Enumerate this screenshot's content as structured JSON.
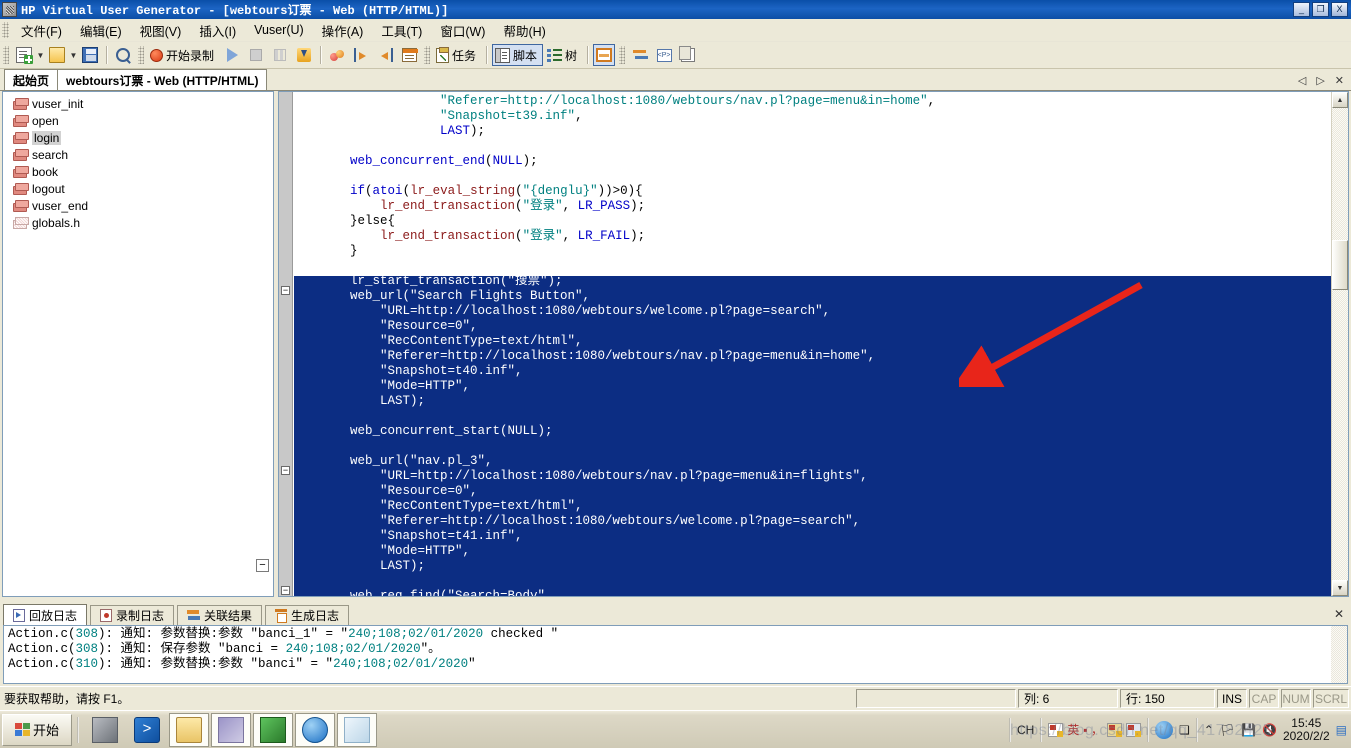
{
  "window": {
    "title": "HP Virtual User Generator - [webtours订票 - Web (HTTP/HTML)]",
    "minimize_label": "_",
    "maximize_label": "❐",
    "close_label": "X"
  },
  "menu": {
    "items": [
      {
        "label": "文件(F)"
      },
      {
        "label": "编辑(E)"
      },
      {
        "label": "视图(V)"
      },
      {
        "label": "插入(I)"
      },
      {
        "label": "Vuser(U)"
      },
      {
        "label": "操作(A)"
      },
      {
        "label": "工具(T)"
      },
      {
        "label": "窗口(W)"
      },
      {
        "label": "帮助(H)"
      }
    ]
  },
  "toolbar": {
    "new_script": "new-script",
    "open": "open-folder",
    "save": "save",
    "find": "find",
    "record_label": "开始录制",
    "run": "run",
    "stop": "stop",
    "pause": "pause",
    "download": "download",
    "cherry": "runtime-settings",
    "prev_step": "previous-step",
    "next_step": "next-step",
    "params": "parameter-list",
    "task_label": "任务",
    "script_label": "脚本",
    "tree_label": "树",
    "split": "split-view",
    "sync": "sync",
    "snapshot_p": "snapshot",
    "copy": "copy"
  },
  "doc_tabs": {
    "tabs": [
      {
        "label": "起始页",
        "active": false
      },
      {
        "label": "webtours订票 - Web (HTTP/HTML)",
        "active": true
      }
    ],
    "nav_prev": "◁",
    "nav_next": "▷",
    "close": "✕"
  },
  "tree": {
    "items": [
      {
        "label": "vuser_init",
        "icon": "action-icon",
        "selected": false
      },
      {
        "label": "open",
        "icon": "action-icon",
        "selected": false
      },
      {
        "label": "login",
        "icon": "action-icon",
        "selected": true
      },
      {
        "label": "search",
        "icon": "action-icon",
        "selected": false
      },
      {
        "label": "book",
        "icon": "action-icon",
        "selected": false
      },
      {
        "label": "logout",
        "icon": "action-icon",
        "selected": false
      },
      {
        "label": "vuser_end",
        "icon": "action-icon",
        "selected": false
      },
      {
        "label": "globals.h",
        "icon": "header-file-icon",
        "selected": false
      }
    ],
    "collapse_label": "−"
  },
  "editor": {
    "fold_markers": [
      "−",
      "−",
      "−"
    ],
    "lines": [
      {
        "indent": 4,
        "selected": false,
        "tokens": [
          {
            "t": "\"Referer=http://localhost:1080/webtours/nav.pl?page=menu&in=home\"",
            "c": "st"
          },
          {
            "t": ",",
            "c": "pl"
          }
        ]
      },
      {
        "indent": 4,
        "selected": false,
        "tokens": [
          {
            "t": "\"Snapshot=t39.inf\"",
            "c": "st"
          },
          {
            "t": ",",
            "c": "pl"
          }
        ]
      },
      {
        "indent": 4,
        "selected": false,
        "tokens": [
          {
            "t": "LAST",
            "c": "k"
          },
          {
            "t": ");",
            "c": "pl"
          }
        ]
      },
      {
        "indent": 0,
        "selected": false,
        "tokens": []
      },
      {
        "indent": 1,
        "selected": false,
        "tokens": [
          {
            "t": "web_concurrent_end",
            "c": "k"
          },
          {
            "t": "(",
            "c": "pl"
          },
          {
            "t": "NULL",
            "c": "k"
          },
          {
            "t": ");",
            "c": "pl"
          }
        ]
      },
      {
        "indent": 0,
        "selected": false,
        "tokens": []
      },
      {
        "indent": 1,
        "selected": false,
        "tokens": [
          {
            "t": "if",
            "c": "k"
          },
          {
            "t": "(",
            "c": "pl"
          },
          {
            "t": "atoi",
            "c": "k"
          },
          {
            "t": "(",
            "c": "pl"
          },
          {
            "t": "lr_eval_string",
            "c": "fn"
          },
          {
            "t": "(",
            "c": "pl"
          },
          {
            "t": "\"{denglu}\"",
            "c": "st"
          },
          {
            "t": "))>0){",
            "c": "pl"
          }
        ]
      },
      {
        "indent": 2,
        "selected": false,
        "tokens": [
          {
            "t": "lr_end_transaction",
            "c": "fn"
          },
          {
            "t": "(",
            "c": "pl"
          },
          {
            "t": "\"登录\"",
            "c": "st"
          },
          {
            "t": ", ",
            "c": "pl"
          },
          {
            "t": "LR_PASS",
            "c": "k"
          },
          {
            "t": ");",
            "c": "pl"
          }
        ]
      },
      {
        "indent": 1,
        "selected": false,
        "tokens": [
          {
            "t": "}else{",
            "c": "pl"
          }
        ]
      },
      {
        "indent": 2,
        "selected": false,
        "tokens": [
          {
            "t": "lr_end_transaction",
            "c": "fn"
          },
          {
            "t": "(",
            "c": "pl"
          },
          {
            "t": "\"登录\"",
            "c": "st"
          },
          {
            "t": ", ",
            "c": "pl"
          },
          {
            "t": "LR_FAIL",
            "c": "k"
          },
          {
            "t": ");",
            "c": "pl"
          }
        ]
      },
      {
        "indent": 1,
        "selected": false,
        "tokens": [
          {
            "t": "}",
            "c": "pl"
          }
        ]
      },
      {
        "indent": 0,
        "selected": false,
        "tokens": []
      },
      {
        "indent": 1,
        "selected": true,
        "tokens": [
          {
            "t": "lr_start_transaction(\"搜票\");",
            "c": "w"
          }
        ]
      },
      {
        "indent": 1,
        "selected": true,
        "tokens": [
          {
            "t": "web_url(\"Search Flights Button\",",
            "c": "w"
          }
        ]
      },
      {
        "indent": 2,
        "selected": true,
        "tokens": [
          {
            "t": "\"URL=http://localhost:1080/webtours/welcome.pl?page=search\",",
            "c": "w"
          }
        ]
      },
      {
        "indent": 2,
        "selected": true,
        "tokens": [
          {
            "t": "\"Resource=0\",",
            "c": "w"
          }
        ]
      },
      {
        "indent": 2,
        "selected": true,
        "tokens": [
          {
            "t": "\"RecContentType=text/html\",",
            "c": "w"
          }
        ]
      },
      {
        "indent": 2,
        "selected": true,
        "tokens": [
          {
            "t": "\"Referer=http://localhost:1080/webtours/nav.pl?page=menu&in=home\",",
            "c": "w"
          }
        ]
      },
      {
        "indent": 2,
        "selected": true,
        "tokens": [
          {
            "t": "\"Snapshot=t40.inf\",",
            "c": "w"
          }
        ]
      },
      {
        "indent": 2,
        "selected": true,
        "tokens": [
          {
            "t": "\"Mode=HTTP\",",
            "c": "w"
          }
        ]
      },
      {
        "indent": 2,
        "selected": true,
        "tokens": [
          {
            "t": "LAST);",
            "c": "w"
          }
        ]
      },
      {
        "indent": 0,
        "selected": true,
        "tokens": []
      },
      {
        "indent": 1,
        "selected": true,
        "tokens": [
          {
            "t": "web_concurrent_start(NULL);",
            "c": "w"
          }
        ]
      },
      {
        "indent": 0,
        "selected": true,
        "tokens": []
      },
      {
        "indent": 1,
        "selected": true,
        "tokens": [
          {
            "t": "web_url(\"nav.pl_3\",",
            "c": "w"
          }
        ]
      },
      {
        "indent": 2,
        "selected": true,
        "tokens": [
          {
            "t": "\"URL=http://localhost:1080/webtours/nav.pl?page=menu&in=flights\",",
            "c": "w"
          }
        ]
      },
      {
        "indent": 2,
        "selected": true,
        "tokens": [
          {
            "t": "\"Resource=0\",",
            "c": "w"
          }
        ]
      },
      {
        "indent": 2,
        "selected": true,
        "tokens": [
          {
            "t": "\"RecContentType=text/html\",",
            "c": "w"
          }
        ]
      },
      {
        "indent": 2,
        "selected": true,
        "tokens": [
          {
            "t": "\"Referer=http://localhost:1080/webtours/welcome.pl?page=search\",",
            "c": "w"
          }
        ]
      },
      {
        "indent": 2,
        "selected": true,
        "tokens": [
          {
            "t": "\"Snapshot=t41.inf\",",
            "c": "w"
          }
        ]
      },
      {
        "indent": 2,
        "selected": true,
        "tokens": [
          {
            "t": "\"Mode=HTTP\",",
            "c": "w"
          }
        ]
      },
      {
        "indent": 2,
        "selected": true,
        "tokens": [
          {
            "t": "LAST);",
            "c": "w"
          }
        ]
      },
      {
        "indent": 0,
        "selected": true,
        "tokens": []
      },
      {
        "indent": 1,
        "selected": true,
        "tokens": [
          {
            "t": "web_reg_find(\"Search=Body\",",
            "c": "w"
          }
        ]
      }
    ]
  },
  "log_tabs": {
    "tabs": [
      {
        "label": "回放日志",
        "icon": "replay-log-icon",
        "active": true
      },
      {
        "label": "录制日志",
        "icon": "record-log-icon",
        "active": false
      },
      {
        "label": "关联结果",
        "icon": "correlation-icon",
        "active": false
      },
      {
        "label": "生成日志",
        "icon": "generation-log-icon",
        "active": false
      }
    ],
    "close_label": "✕"
  },
  "log": {
    "lines": [
      {
        "file": "Action.c(",
        "line": "308",
        "rest1": "): 通知: 参数替换:参数 \"banci_1\" = \"",
        "value": "240;108;02/01/2020",
        "rest2": " checked \""
      },
      {
        "file": "Action.c(",
        "line": "308",
        "rest1": "): 通知: 保存参数 \"banci = ",
        "value": "240;108;02/01/2020",
        "rest2": "\"。"
      },
      {
        "file": "Action.c(",
        "line": "310",
        "rest1": "): 通知: 参数替换:参数 \"banci\" = \"",
        "value": "240;108;02/01/2020",
        "rest2": "\""
      }
    ]
  },
  "statusbar": {
    "help_text": "要获取帮助，请按 F1。",
    "column": "列: 6",
    "row": "行: 150",
    "ins": "INS",
    "cap": "CAP",
    "num": "NUM",
    "scrl": "SCRL"
  },
  "taskbar": {
    "start_label": "开始",
    "quick_launch": [
      {
        "name": "server-manager-icon"
      },
      {
        "name": "powershell-icon"
      },
      {
        "name": "file-explorer-icon",
        "active": false
      },
      {
        "name": "media-icon",
        "active": false
      },
      {
        "name": "vugen-icon",
        "active": true
      },
      {
        "name": "internet-explorer-icon",
        "active": false
      },
      {
        "name": "notepad-icon",
        "active": false
      }
    ],
    "tray": {
      "lang": "CH",
      "ime_mode": "英",
      "time": "15:45",
      "date": "2020/2/2"
    }
  },
  "watermark": "https://blog.csdn.net/qq_41782425",
  "colors": {
    "titlebar": "#0a4fa8",
    "selection": "#0c2d83",
    "string": "#008080",
    "keyword": "#0000c8",
    "function": "#8b1a1a",
    "arrow": "#e8251a"
  }
}
